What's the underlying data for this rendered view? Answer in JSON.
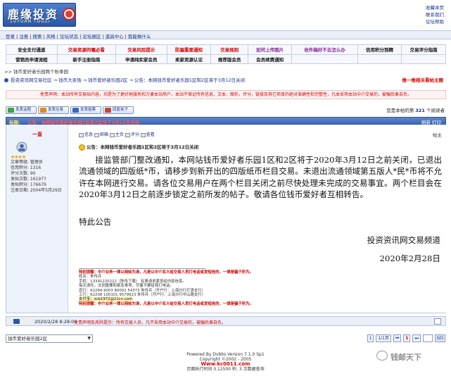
{
  "header": {
    "logo_title": "鹿缘投资",
    "logo_sub": "LUYUAN TOUZI",
    "top_links": [
      "收藏本页",
      "联系我们",
      "论坛帮助"
    ]
  },
  "nav": [
    "登录",
    "注册",
    "搜索",
    "风格",
    "论坛状态",
    "论坛展区",
    "道具中心",
    "我能做什么"
  ],
  "grid": {
    "row1": [
      "安全支付通道",
      "交易资源的嘱必看",
      "交易风险提示",
      "防骗重要通知",
      "交易规则",
      "如何上传图片",
      "收件稿好不去怎么办",
      "信用积分到精",
      "交易评分指南"
    ],
    "row2": [
      "营销员申请流程",
      "新手注册指南",
      "申请纯实家会员",
      "卖家资源认证",
      "推荐版会员",
      "会员续费通知"
    ]
  },
  "path": {
    "line1": ">> 钱币爱好者乐园两个秋季园",
    "line2": "投资资讯网交易社区 → 钱币大卖场 → 钱币爱好者乐园2区 → 公告：本网钱币爱好者乐园1区和2区将于3月12日关闭",
    "right": "推一推相关看帖主题"
  },
  "disclaimer": "免责声明：本站所有交易贴内容，均是为了更好地服务和方便本站用户，本站不保证所有信息，文本，图形，评分，链接及其它项目的绝对准确性和完整性，凡本采用本站中介交易的，被骗后果自负。",
  "toolbar": {
    "buttons": [
      "发表话题",
      "发表交易",
      "发表投票",
      "回复帖子"
    ],
    "readers_prefix": "您是本帖的第",
    "readers_count": "321",
    "readers_suffix": "个阅读者"
  },
  "post": {
    "header_label": "标题:",
    "header_title": "公告：本网钱币爱好者乐园1区和2区将于3月12日关闭",
    "actions": "刷新  打印",
    "author": {
      "name": "一直",
      "stars": "★★★★",
      "info": [
        "文章等级: 管理员",
        "信用积分: 1316",
        "评分次数: 90",
        "发贴次数: 161977",
        "发贴积分: 176679",
        "注册日期: 2004年5月29日"
      ]
    },
    "tools": [
      "信息",
      "邮箱",
      "主页",
      "评分",
      "查看"
    ],
    "floor": "帖主",
    "subject": "公告：本网钱币爱好者乐园1区和2区将于3月12日关闭",
    "body": "接监管部门整改通知，本网站钱币爱好者乐园1区和2区将于2020年3月12日之前关闭，已退出流通领域的四版纸*币，请移步到新开出的四版纸币栏目交易。未退出流通领域第五版人*民*币将不允许在本网进行交易。请各位交易用户在两个栏目关闭之前尽快处理未完成的交易事宜。两个栏目会在2020年3月12日之前逐步锁定之前所发的帖子。敬请各位钱币爱好者互相转告。",
    "special": "特此公告",
    "sign_org": "投资资讯网交易频道",
    "sign_date": "2020年2月28日",
    "sig": {
      "warn1": "特别提醒：中介业务一律以网帖为准，凡是以中介名义给交易人员打电话或发短信的，一律是骗子所为。",
      "lines": [
        "姓名：朱传兵",
        "手机：13391220222（陈传下载）   有事请求紧发给内容信息。",
        "每天请托，交割重要和紧急事项，尽量不要给我打电话。",
        "农行：62284 9003 80002 54373 朱传兵（开户行：上海分行打清支行）",
        "工行：62208 100101 9579923 朱传兵（开户行：上海分行中山路支行）"
      ],
      "qq": "支付宝：zcb1972@21cn.com",
      "warn2": "特别提醒：中介业务一律以网帖为准，凡是以中介名义给交易人员打电话或发短信的，一律是骗子所为。"
    },
    "time": "2020/2/28 8:28:00",
    "foot_note": "免责声明及风险提示：所有交易人员，凡不采用本站中介交易的，被骗后果自负。"
  },
  "bottom": {
    "forum_select": "钱币爱好者乐园2区",
    "pager": [
      "1",
      "1/1页",
      "1",
      "GO"
    ]
  },
  "footer": {
    "powered": "Powered By Dvbbs Version 7.1.0 Sp1",
    "copyright": "Copyright ©2002 - 2005",
    "site": "Www.kc0011.com",
    "exec": "页面执行时间 0.12500 秒, 3 次数据查询"
  },
  "watermark": "钱邮天下",
  "colors": {
    "accent_blue": "#3e67b2",
    "alert_red": "#d60000",
    "header_title": "#ff5b5b"
  }
}
